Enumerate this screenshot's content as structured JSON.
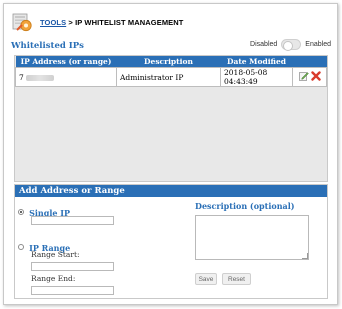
{
  "breadcrumb": {
    "tools_link": "TOOLS",
    "separator": ">",
    "current": "IP WHITELIST MANAGEMENT"
  },
  "whitelist": {
    "title": "Whitelisted IPs",
    "toggle": {
      "disabled_label": "Disabled",
      "enabled_label": "Enabled",
      "state": "disabled"
    },
    "columns": [
      "IP Address (or range)",
      "Description",
      "Date Modified",
      ""
    ],
    "rows": [
      {
        "ip_prefix": "7",
        "description": "Administrator IP",
        "date_modified": "2018-05-08 04:43:49"
      }
    ]
  },
  "add_form": {
    "title": "Add Address or Range",
    "single_ip_label": "Single IP",
    "single_ip_value": "",
    "ip_range_label": "IP Range",
    "range_start_label": "Range Start:",
    "range_start_value": "",
    "range_end_label": "Range End:",
    "range_end_value": "",
    "description_label": "Description (optional)",
    "description_value": "",
    "save_label": "Save",
    "reset_label": "Reset",
    "selected_mode": "single"
  },
  "colors": {
    "accent": "#2a6fb6",
    "link": "#1a56a6",
    "delete": "#d93a2b"
  },
  "icons": {
    "tools": "tools-icon",
    "edit": "edit-icon",
    "delete": "delete-icon"
  }
}
